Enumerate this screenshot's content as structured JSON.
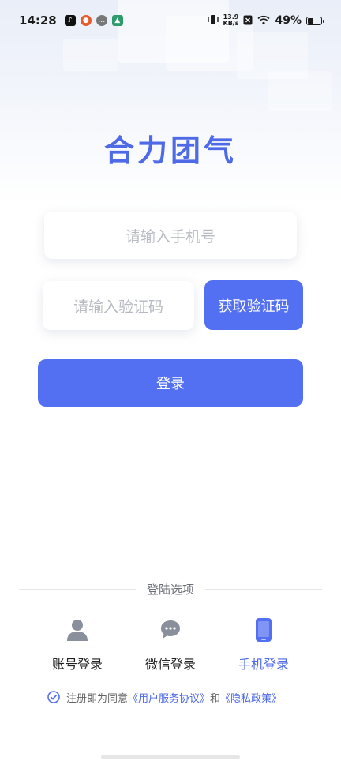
{
  "status_bar": {
    "time": "14:28",
    "net_speed_value": "13.9",
    "net_speed_unit": "KB/s",
    "battery_percent": "49%",
    "battery_level": 0.49,
    "notification_icons": [
      "tiktok-icon",
      "weibo-icon",
      "wechat-icon",
      "app-icon"
    ]
  },
  "app_title": "合力团气",
  "phone_input": {
    "placeholder": "请输入手机号"
  },
  "code_input": {
    "placeholder": "请输入验证码"
  },
  "get_code_label": "获取验证码",
  "login_label": "登录",
  "options_title": "登陆选项",
  "login_options": [
    {
      "label": "账号登录",
      "icon": "user-icon",
      "active": false
    },
    {
      "label": "微信登录",
      "icon": "chat-bubble-icon",
      "active": false
    },
    {
      "label": "手机登录",
      "icon": "phone-icon",
      "active": true
    }
  ],
  "agreement": {
    "prefix": "注册即为同意",
    "terms_link": "《用户服务协议》",
    "and_text": "和",
    "privacy_link": "《隐私政策》",
    "checked": true
  },
  "colors": {
    "accent": "#5470f2",
    "title": "#4e6ae6",
    "placeholder": "#b7bac2"
  }
}
